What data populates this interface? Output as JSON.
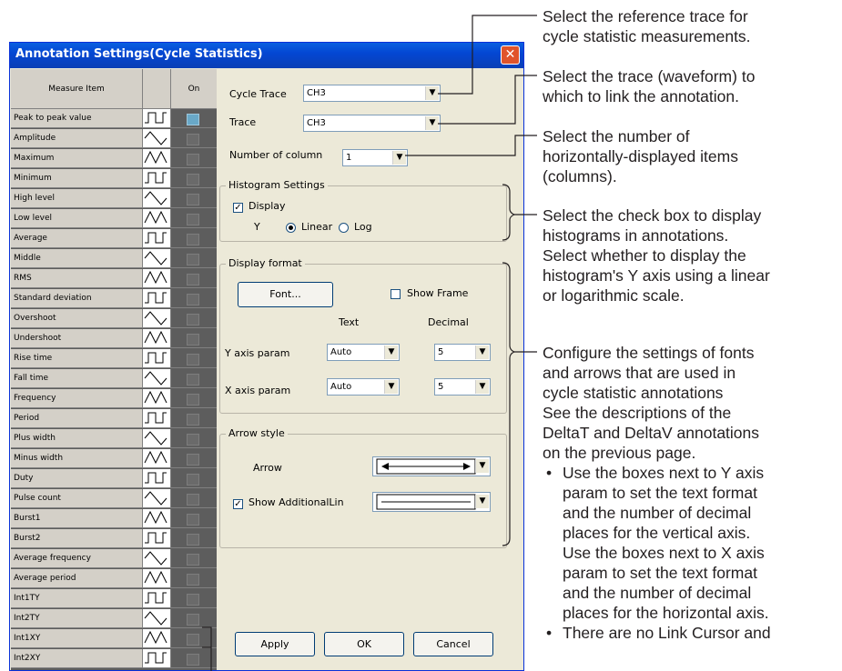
{
  "dialog": {
    "title": "Annotation Settings(Cycle Statistics)",
    "close_glyph": "✕"
  },
  "measure_table": {
    "col_item": "Measure Item",
    "col_on": "On",
    "rows": [
      {
        "label": "Peak to peak value",
        "on": true
      },
      {
        "label": "Amplitude",
        "on": false
      },
      {
        "label": "Maximum",
        "on": false
      },
      {
        "label": "Minimum",
        "on": false
      },
      {
        "label": "High level",
        "on": false
      },
      {
        "label": "Low level",
        "on": false
      },
      {
        "label": "Average",
        "on": false
      },
      {
        "label": "Middle",
        "on": false
      },
      {
        "label": "RMS",
        "on": false
      },
      {
        "label": "Standard deviation",
        "on": false
      },
      {
        "label": "Overshoot",
        "on": false
      },
      {
        "label": "Undershoot",
        "on": false
      },
      {
        "label": "Rise time",
        "on": false
      },
      {
        "label": "Fall time",
        "on": false
      },
      {
        "label": "Frequency",
        "on": false
      },
      {
        "label": "Period",
        "on": false
      },
      {
        "label": "Plus width",
        "on": false
      },
      {
        "label": "Minus width",
        "on": false
      },
      {
        "label": "Duty",
        "on": false
      },
      {
        "label": "Pulse count",
        "on": false
      },
      {
        "label": "Burst1",
        "on": false
      },
      {
        "label": "Burst2",
        "on": false
      },
      {
        "label": "Average frequency",
        "on": false
      },
      {
        "label": "Average period",
        "on": false
      },
      {
        "label": "Int1TY",
        "on": false
      },
      {
        "label": "Int2TY",
        "on": false
      },
      {
        "label": "Int1XY",
        "on": false
      },
      {
        "label": "Int2XY",
        "on": false
      }
    ]
  },
  "settings": {
    "cycle_trace_label": "Cycle Trace",
    "cycle_trace_value": "CH3",
    "trace_label": "Trace",
    "trace_value": "CH3",
    "num_column_label": "Number of column",
    "num_column_value": "1",
    "histogram": {
      "title": "Histogram Settings",
      "display_label": "Display",
      "display_checked": true,
      "y_label": "Y",
      "linear_label": "Linear",
      "log_label": "Log",
      "selected": "Linear"
    },
    "display_format": {
      "title": "Display format",
      "font_button": "Font...",
      "show_frame_label": "Show Frame",
      "text_header": "Text",
      "decimal_header": "Decimal",
      "y_axis_label": "Y axis param",
      "y_text": "Auto",
      "y_decimal": "5",
      "x_axis_label": "X axis param",
      "x_text": "Auto",
      "x_decimal": "5"
    },
    "arrow_style": {
      "title": "Arrow style",
      "arrow_label": "Arrow",
      "show_additional_label": "Show AdditionalLin",
      "show_additional_checked": true
    },
    "buttons": {
      "apply": "Apply",
      "ok": "OK",
      "cancel": "Cancel"
    }
  },
  "annotations": {
    "a1": [
      "Select the reference trace for",
      "cycle statistic measurements."
    ],
    "a2": [
      "Select the trace (waveform) to",
      "which to link the annotation."
    ],
    "a3": [
      "Select the number of",
      "horizontally-displayed items",
      "(columns)."
    ],
    "a4": [
      "Select the check box to display",
      "histograms in annotations.",
      "Select whether to display the",
      "histogram's Y axis using a linear",
      "or logarithmic scale."
    ],
    "a5": [
      "Configure the settings of fonts",
      "and arrows that are used in",
      "cycle statistic annotations",
      "See the descriptions of the",
      "DeltaT and DeltaV annotations",
      "on the previous page."
    ],
    "b1": [
      "Use the boxes next to Y axis",
      "param to set the text format",
      "and the number of decimal",
      "places for the vertical axis.",
      "Use the boxes next to X axis",
      "param to set the text format",
      "and the number of decimal",
      "places for the horizontal axis."
    ],
    "b2": [
      "There are no Link Cursor and"
    ],
    "bullet_glyph": "•"
  },
  "colors": {
    "titlebar": "#0a5fe0",
    "close": "#e0542b",
    "dialog_bg": "#ece9d8"
  }
}
